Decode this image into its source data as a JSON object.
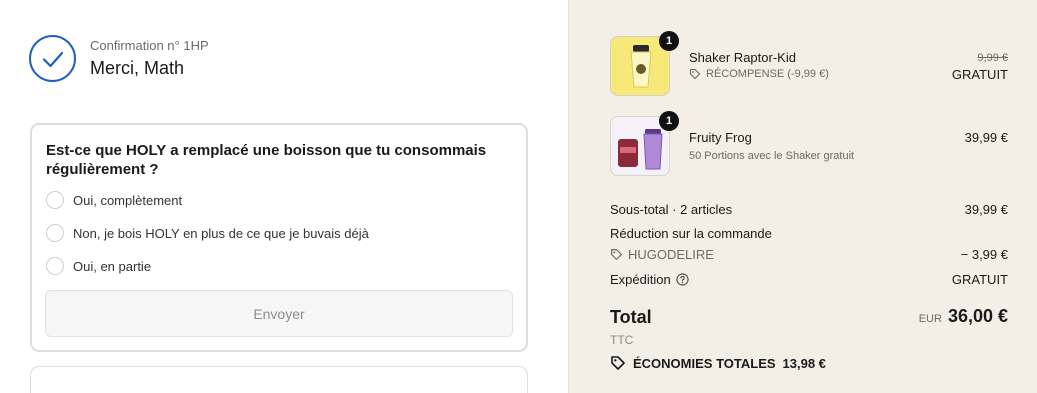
{
  "confirmation": {
    "number_label": "Confirmation n° 1HP",
    "title": "Merci, Math"
  },
  "survey": {
    "question": "Est-ce que HOLY a remplacé une boisson que tu consommais régulièrement ?",
    "options": [
      {
        "label": "Oui, complètement"
      },
      {
        "label": "Non, je bois HOLY en plus de ce que je buvais déjà"
      },
      {
        "label": "Oui, en partie"
      }
    ],
    "submit_label": "Envoyer"
  },
  "order": {
    "items": [
      {
        "name": "Shaker Raptor-Kid",
        "subtitle": "RÉCOMPENSE (-9,99 €)",
        "subtitle_icon": "tag-icon",
        "quantity": "1",
        "original_price": "9,99 €",
        "price": "GRATUIT"
      },
      {
        "name": "Fruity Frog",
        "subtitle": "50 Portions avec le Shaker gratuit",
        "quantity": "1",
        "price": "39,99 €"
      }
    ],
    "subtotal_label": "Sous-total · 2 articles",
    "subtotal_value": "39,99 €",
    "discount_label": "Réduction sur la commande",
    "discount_code": "HUGODELIRE",
    "discount_value": "− 3,99 €",
    "shipping_label": "Expédition",
    "shipping_value": "GRATUIT",
    "total_label": "Total",
    "total_currency": "EUR",
    "total_value": "36,00 €",
    "tax_note": "TTC",
    "savings_label": "ÉCONOMIES TOTALES",
    "savings_value": "13,98 €"
  },
  "colors": {
    "accent": "#1f5fbf",
    "summary_background": "#f3eee6",
    "shaker_yellow": "#f6e97a"
  }
}
